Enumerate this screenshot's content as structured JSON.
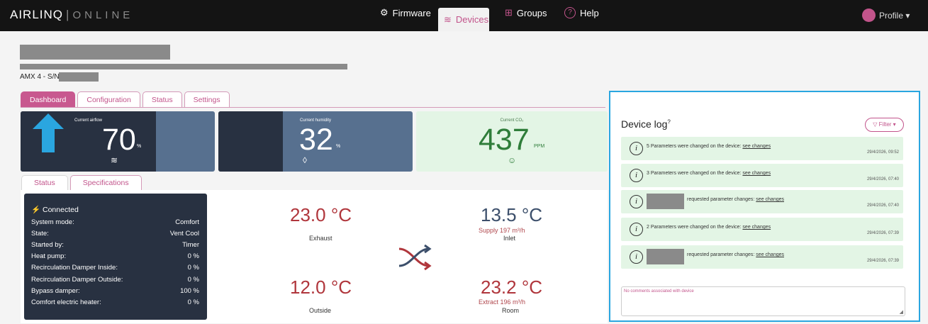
{
  "brand": {
    "name": "AIRLINQ",
    "separator": "|",
    "suffix": "ONLINE"
  },
  "nav": {
    "firmware": "Firmware",
    "devices": "Devices",
    "groups": "Groups",
    "help": "Help",
    "profile": "Profile ▾"
  },
  "device": {
    "serial_prefix": "AMX 4 - S/N"
  },
  "tabs": [
    "Dashboard",
    "Configuration",
    "Status",
    "Settings"
  ],
  "kpis": {
    "airflow": {
      "caption": "Current airflow",
      "value": "70",
      "unit": "%"
    },
    "humidity": {
      "caption": "Current humidity",
      "value": "32",
      "unit": "%"
    },
    "co2": {
      "caption": "Current CO₂",
      "value": "437",
      "unit": "PPM"
    }
  },
  "subtabs": [
    "Status",
    "Specifications"
  ],
  "status": {
    "connected": "Connected",
    "rows": [
      {
        "label": "System mode:",
        "value": "Comfort"
      },
      {
        "label": "State:",
        "value": "Vent Cool"
      },
      {
        "label": "Started by:",
        "value": "Timer"
      },
      {
        "label": "Heat pump:",
        "value": "0 %"
      },
      {
        "label": "Recirculation Damper Inside:",
        "value": "0 %"
      },
      {
        "label": "Recirculation Damper Outside:",
        "value": "0 %"
      },
      {
        "label": "Bypass damper:",
        "value": "100 %"
      },
      {
        "label": "Comfort electric heater:",
        "value": "0 %"
      }
    ]
  },
  "temps": {
    "exhaust": {
      "value": "23.0 °C",
      "label": "Exhaust"
    },
    "inlet": {
      "value": "13.5 °C",
      "sub": "Supply 197 m³/h",
      "label": "Inlet"
    },
    "outside": {
      "value": "12.0 °C",
      "label": "Outside"
    },
    "room": {
      "value": "23.2 °C",
      "sub": "Extract 196 m³/h",
      "label": "Room"
    }
  },
  "colors": {
    "accent": "#c2548b",
    "warm": "#b0363c",
    "cool": "#3c4f6b",
    "log_border": "#2aa6e0"
  },
  "log": {
    "title": "Device log",
    "help_mark": "?",
    "filter": "▽ Filter ▾",
    "link": "see changes",
    "items": [
      {
        "text": "5 Parameters were changed on the device: ",
        "date": "29/4/2026, 09:52"
      },
      {
        "text": "3 Parameters were changed on the device: ",
        "date": "29/4/2026, 07:40"
      },
      {
        "text": "requested parameter changes: ",
        "date": "29/4/2026, 07:40"
      },
      {
        "text": "2 Parameters were changed on the device: ",
        "date": "29/4/2026, 07:39"
      },
      {
        "text": "requested parameter changes: ",
        "date": "29/4/2026, 07:39"
      }
    ],
    "comments_placeholder": "No comments associated with device"
  }
}
